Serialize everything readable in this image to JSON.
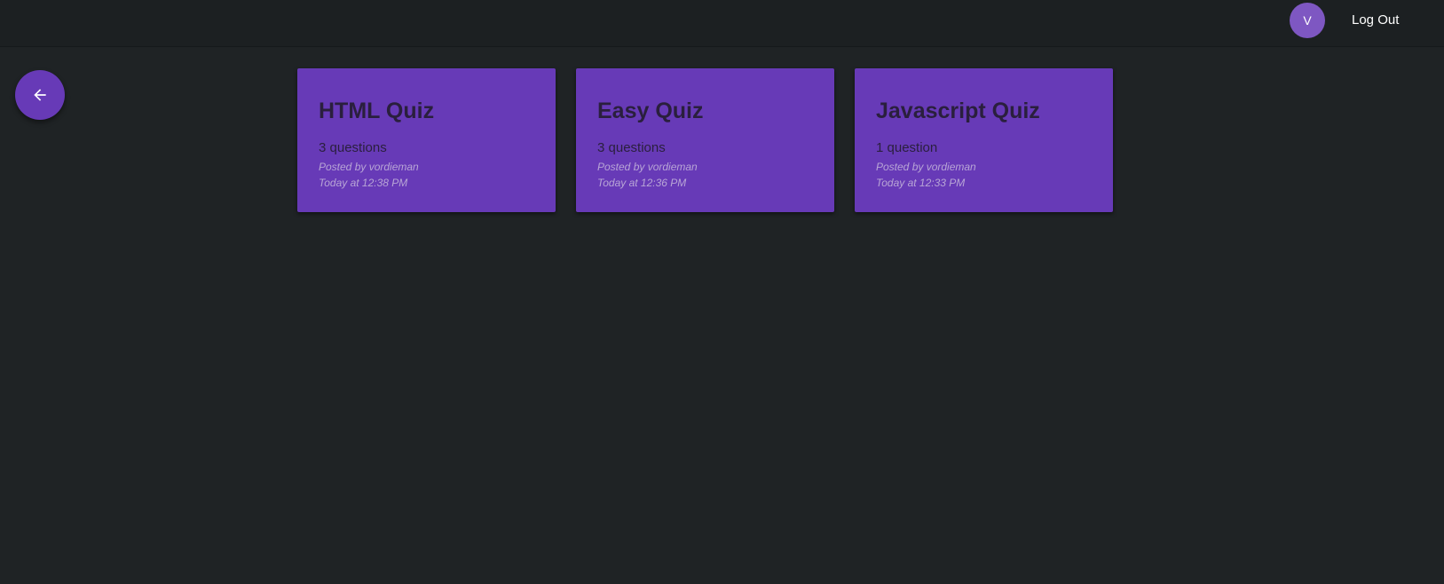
{
  "header": {
    "avatar_initial": "V",
    "logout_label": "Log Out"
  },
  "back_button": {
    "icon": "arrow-left-icon"
  },
  "quizzes": [
    {
      "title": "HTML Quiz",
      "question_count": "3 questions",
      "posted_by": "Posted by vordieman",
      "posted_at": "Today at 12:38 PM"
    },
    {
      "title": "Easy Quiz",
      "question_count": "3 questions",
      "posted_by": "Posted by vordieman",
      "posted_at": "Today at 12:36 PM"
    },
    {
      "title": "Javascript Quiz",
      "question_count": "1 question",
      "posted_by": "Posted by vordieman",
      "posted_at": "Today at 12:33 PM"
    }
  ],
  "colors": {
    "background": "#1f2325",
    "accent": "#673ab7",
    "avatar": "#7e57c2"
  }
}
